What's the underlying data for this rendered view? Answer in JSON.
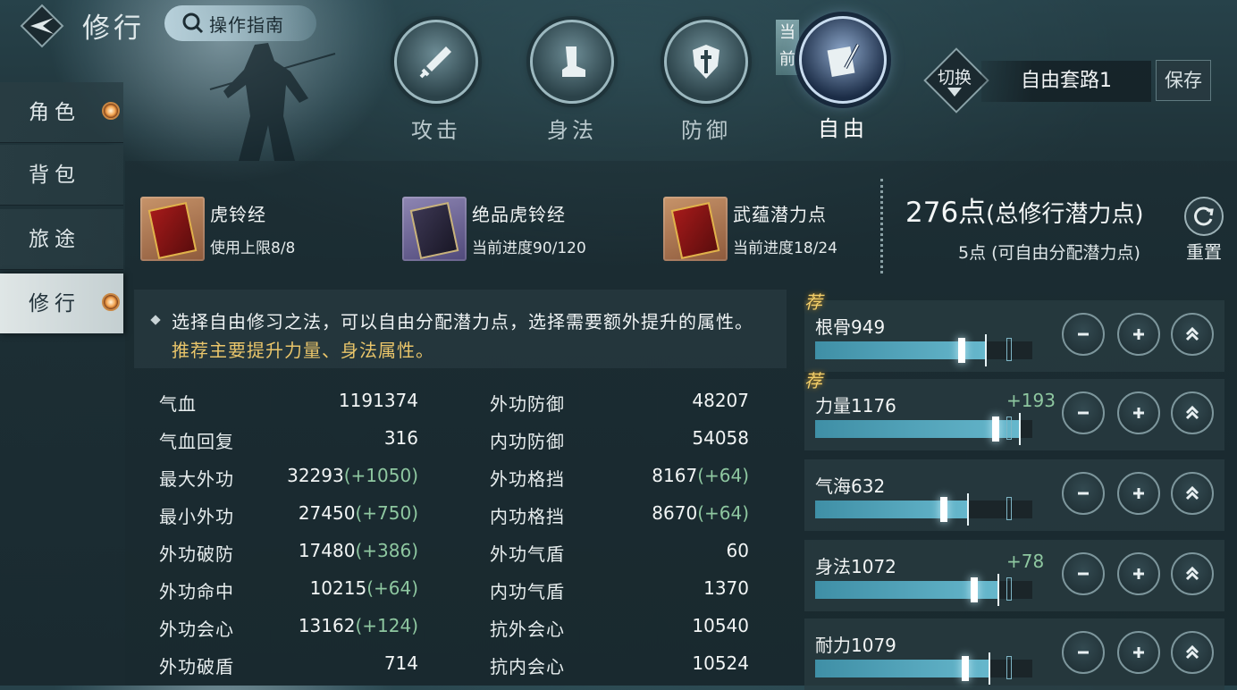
{
  "header": {
    "title": "修行",
    "guide_label": "操作指南"
  },
  "tabs": [
    {
      "label": "攻击",
      "icon": "sword-icon"
    },
    {
      "label": "身法",
      "icon": "boot-icon"
    },
    {
      "label": "防御",
      "icon": "shield-icon"
    },
    {
      "label": "自由",
      "icon": "book-quill-icon",
      "active": true,
      "current_tag": "当前"
    }
  ],
  "preset": {
    "switch_label": "切换",
    "name": "自由套路1",
    "save_label": "保存"
  },
  "sidebar": {
    "items": [
      {
        "label": "角色",
        "dot": true
      },
      {
        "label": "背包",
        "dot": false
      },
      {
        "label": "旅途",
        "dot": false
      },
      {
        "label": "修行",
        "dot": true,
        "active": true
      }
    ]
  },
  "items": [
    {
      "name": "虎铃经",
      "progress": "使用上限8/8",
      "rarity": "orange"
    },
    {
      "name": "绝品虎铃经",
      "progress": "当前进度90/120",
      "rarity": "purple"
    },
    {
      "name": "武蕴潜力点",
      "progress": "当前进度18/24",
      "rarity": "orange"
    }
  ],
  "points": {
    "total_value": "276点",
    "total_label": "(总修行潜力点)",
    "free_text": "5点 (可自由分配潜力点)",
    "reset_label": "重置"
  },
  "description": {
    "text": "选择自由修习之法，可以自由分配潜力点，选择需要额外提升的属性。",
    "highlight": "推荐主要提升力量、身法属性。"
  },
  "stats": [
    {
      "label": "气血",
      "value": "1191374",
      "bonus": "",
      "label2": "外功防御",
      "value2": "48207",
      "bonus2": ""
    },
    {
      "label": "气血回复",
      "value": "316",
      "bonus": "",
      "label2": "内功防御",
      "value2": "54058",
      "bonus2": ""
    },
    {
      "label": "最大外功",
      "value": "32293",
      "bonus": "(+1050)",
      "label2": "外功格挡",
      "value2": "8167",
      "bonus2": "(+64)"
    },
    {
      "label": "最小外功",
      "value": "27450",
      "bonus": "(+750)",
      "label2": "内功格挡",
      "value2": "8670",
      "bonus2": "(+64)"
    },
    {
      "label": "外功破防",
      "value": "17480",
      "bonus": "(+386)",
      "label2": "外功气盾",
      "value2": "60",
      "bonus2": ""
    },
    {
      "label": "外功命中",
      "value": "10215",
      "bonus": "(+64)",
      "label2": "内功气盾",
      "value2": "1370",
      "bonus2": ""
    },
    {
      "label": "外功会心",
      "value": "13162",
      "bonus": "(+124)",
      "label2": "抗外会心",
      "value2": "10540",
      "bonus2": ""
    },
    {
      "label": "外功破盾",
      "value": "714",
      "bonus": "",
      "label2": "抗内会心",
      "value2": "10524",
      "bonus2": ""
    }
  ],
  "attributes": [
    {
      "name": "根骨949",
      "bonus": "",
      "recommended": true,
      "fill": 0.78,
      "marker": 0.88
    },
    {
      "name": "力量1176",
      "bonus": "+193",
      "recommended": true,
      "fill": 0.94,
      "marker": 0.88
    },
    {
      "name": "气海632",
      "bonus": "",
      "recommended": false,
      "fill": 0.7,
      "marker": 0.88
    },
    {
      "name": "身法1072",
      "bonus": "+78",
      "recommended": false,
      "fill": 0.84,
      "marker": 0.88
    },
    {
      "name": "耐力1079",
      "bonus": "",
      "recommended": false,
      "fill": 0.8,
      "marker": 0.88
    }
  ],
  "rec_tag_label": "荐",
  "colors": {
    "accent": "#e9c56a",
    "bonus": "#8ec7a0",
    "bar": "#66b7cc"
  }
}
